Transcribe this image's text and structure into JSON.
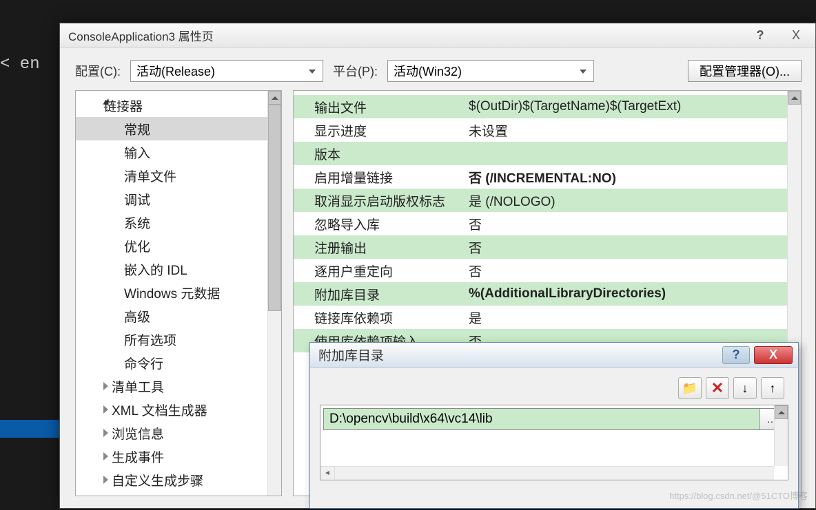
{
  "background_text": " < en",
  "dialog": {
    "title": "ConsoleApplication3 属性页",
    "help": "?",
    "close": "X",
    "config_label": "配置(C):",
    "config_value": "活动(Release)",
    "platform_label": "平台(P):",
    "platform_value": "活动(Win32)",
    "manager_btn": "配置管理器(O)..."
  },
  "tree": [
    {
      "label": "链接器",
      "level": 0,
      "arrow": "open"
    },
    {
      "label": "常规",
      "level": 2,
      "selected": true
    },
    {
      "label": "输入",
      "level": 2
    },
    {
      "label": "清单文件",
      "level": 2
    },
    {
      "label": "调试",
      "level": 2
    },
    {
      "label": "系统",
      "level": 2
    },
    {
      "label": "优化",
      "level": 2
    },
    {
      "label": "嵌入的 IDL",
      "level": 2
    },
    {
      "label": "Windows 元数据",
      "level": 2
    },
    {
      "label": "高级",
      "level": 2
    },
    {
      "label": "所有选项",
      "level": 2
    },
    {
      "label": "命令行",
      "level": 2
    },
    {
      "label": "清单工具",
      "level": 1,
      "arrow": "closed"
    },
    {
      "label": "XML 文档生成器",
      "level": 1,
      "arrow": "closed"
    },
    {
      "label": "浏览信息",
      "level": 1,
      "arrow": "closed"
    },
    {
      "label": "生成事件",
      "level": 1,
      "arrow": "closed"
    },
    {
      "label": "自定义生成步骤",
      "level": 1,
      "arrow": "closed"
    }
  ],
  "props": [
    {
      "name": "输出文件",
      "val": "$(OutDir)$(TargetName)$(TargetExt)",
      "alt": true
    },
    {
      "name": "显示进度",
      "val": "未设置"
    },
    {
      "name": "版本",
      "val": "",
      "alt": true
    },
    {
      "name": "启用增量链接",
      "val": "否 (/INCREMENTAL:NO)",
      "bold": true
    },
    {
      "name": "取消显示启动版权标志",
      "val": "是 (/NOLOGO)",
      "alt": true
    },
    {
      "name": "忽略导入库",
      "val": "否"
    },
    {
      "name": "注册输出",
      "val": "否",
      "alt": true
    },
    {
      "name": "逐用户重定向",
      "val": "否"
    },
    {
      "name": "附加库目录",
      "val": "%(AdditionalLibraryDirectories)",
      "alt": true,
      "bold": true
    },
    {
      "name": "链接库依赖项",
      "val": "是"
    },
    {
      "name": "使用库依赖项输入",
      "val": "否",
      "alt": true
    }
  ],
  "sub_dialog": {
    "title": "附加库目录",
    "help": "?",
    "close": "X",
    "folder_icon": "📁",
    "del_icon": "✕",
    "down_icon": "↓",
    "up_icon": "↑",
    "path": "D:\\opencv\\build\\x64\\vc14\\lib",
    "browse": "..."
  },
  "watermark": "https://blog.csdn.net/@51CTO博客"
}
